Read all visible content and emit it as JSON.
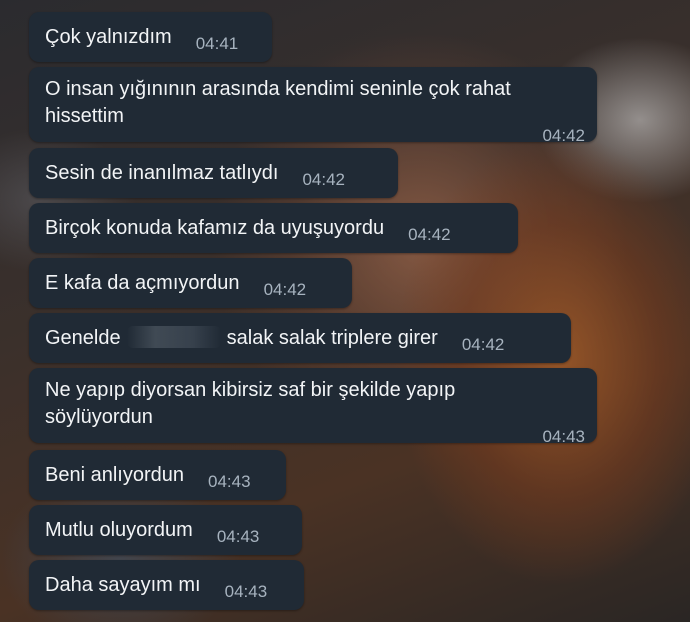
{
  "messages": [
    {
      "text": "Çok yalnızdım",
      "time": "04:41"
    },
    {
      "text": "O insan yığınının arasında kendimi seninle çok rahat hissettim",
      "line1": "O insan yığınının arasında kendimi seninle çok rahat",
      "line2": "hissettim",
      "time": "04:42"
    },
    {
      "text": "Sesin de inanılmaz tatlıydı",
      "time": "04:42"
    },
    {
      "text": "Birçok konuda kafamız da uyuşuyordu",
      "time": "04:42"
    },
    {
      "text": "E kafa da açmıyordun",
      "time": "04:42"
    },
    {
      "text_before": "Genelde",
      "text_after": "salak salak triplere girer",
      "time": "04:42"
    },
    {
      "text": "Ne yapıp diyorsan kibirsiz saf bir şekilde yapıp söylüyordun",
      "line1": "Ne yapıp diyorsan kibirsiz saf bir şekilde yapıp",
      "line2": "söylüyordun",
      "time": "04:43"
    },
    {
      "text": "Beni anlıyordun",
      "time": "04:43"
    },
    {
      "text": "Mutlu oluyordum",
      "time": "04:43"
    },
    {
      "text": "Daha sayayım mı",
      "time": "04:43"
    }
  ],
  "colors": {
    "bubble": "#202a35",
    "text": "#f2f4f6",
    "time": "#a7b3bf"
  }
}
